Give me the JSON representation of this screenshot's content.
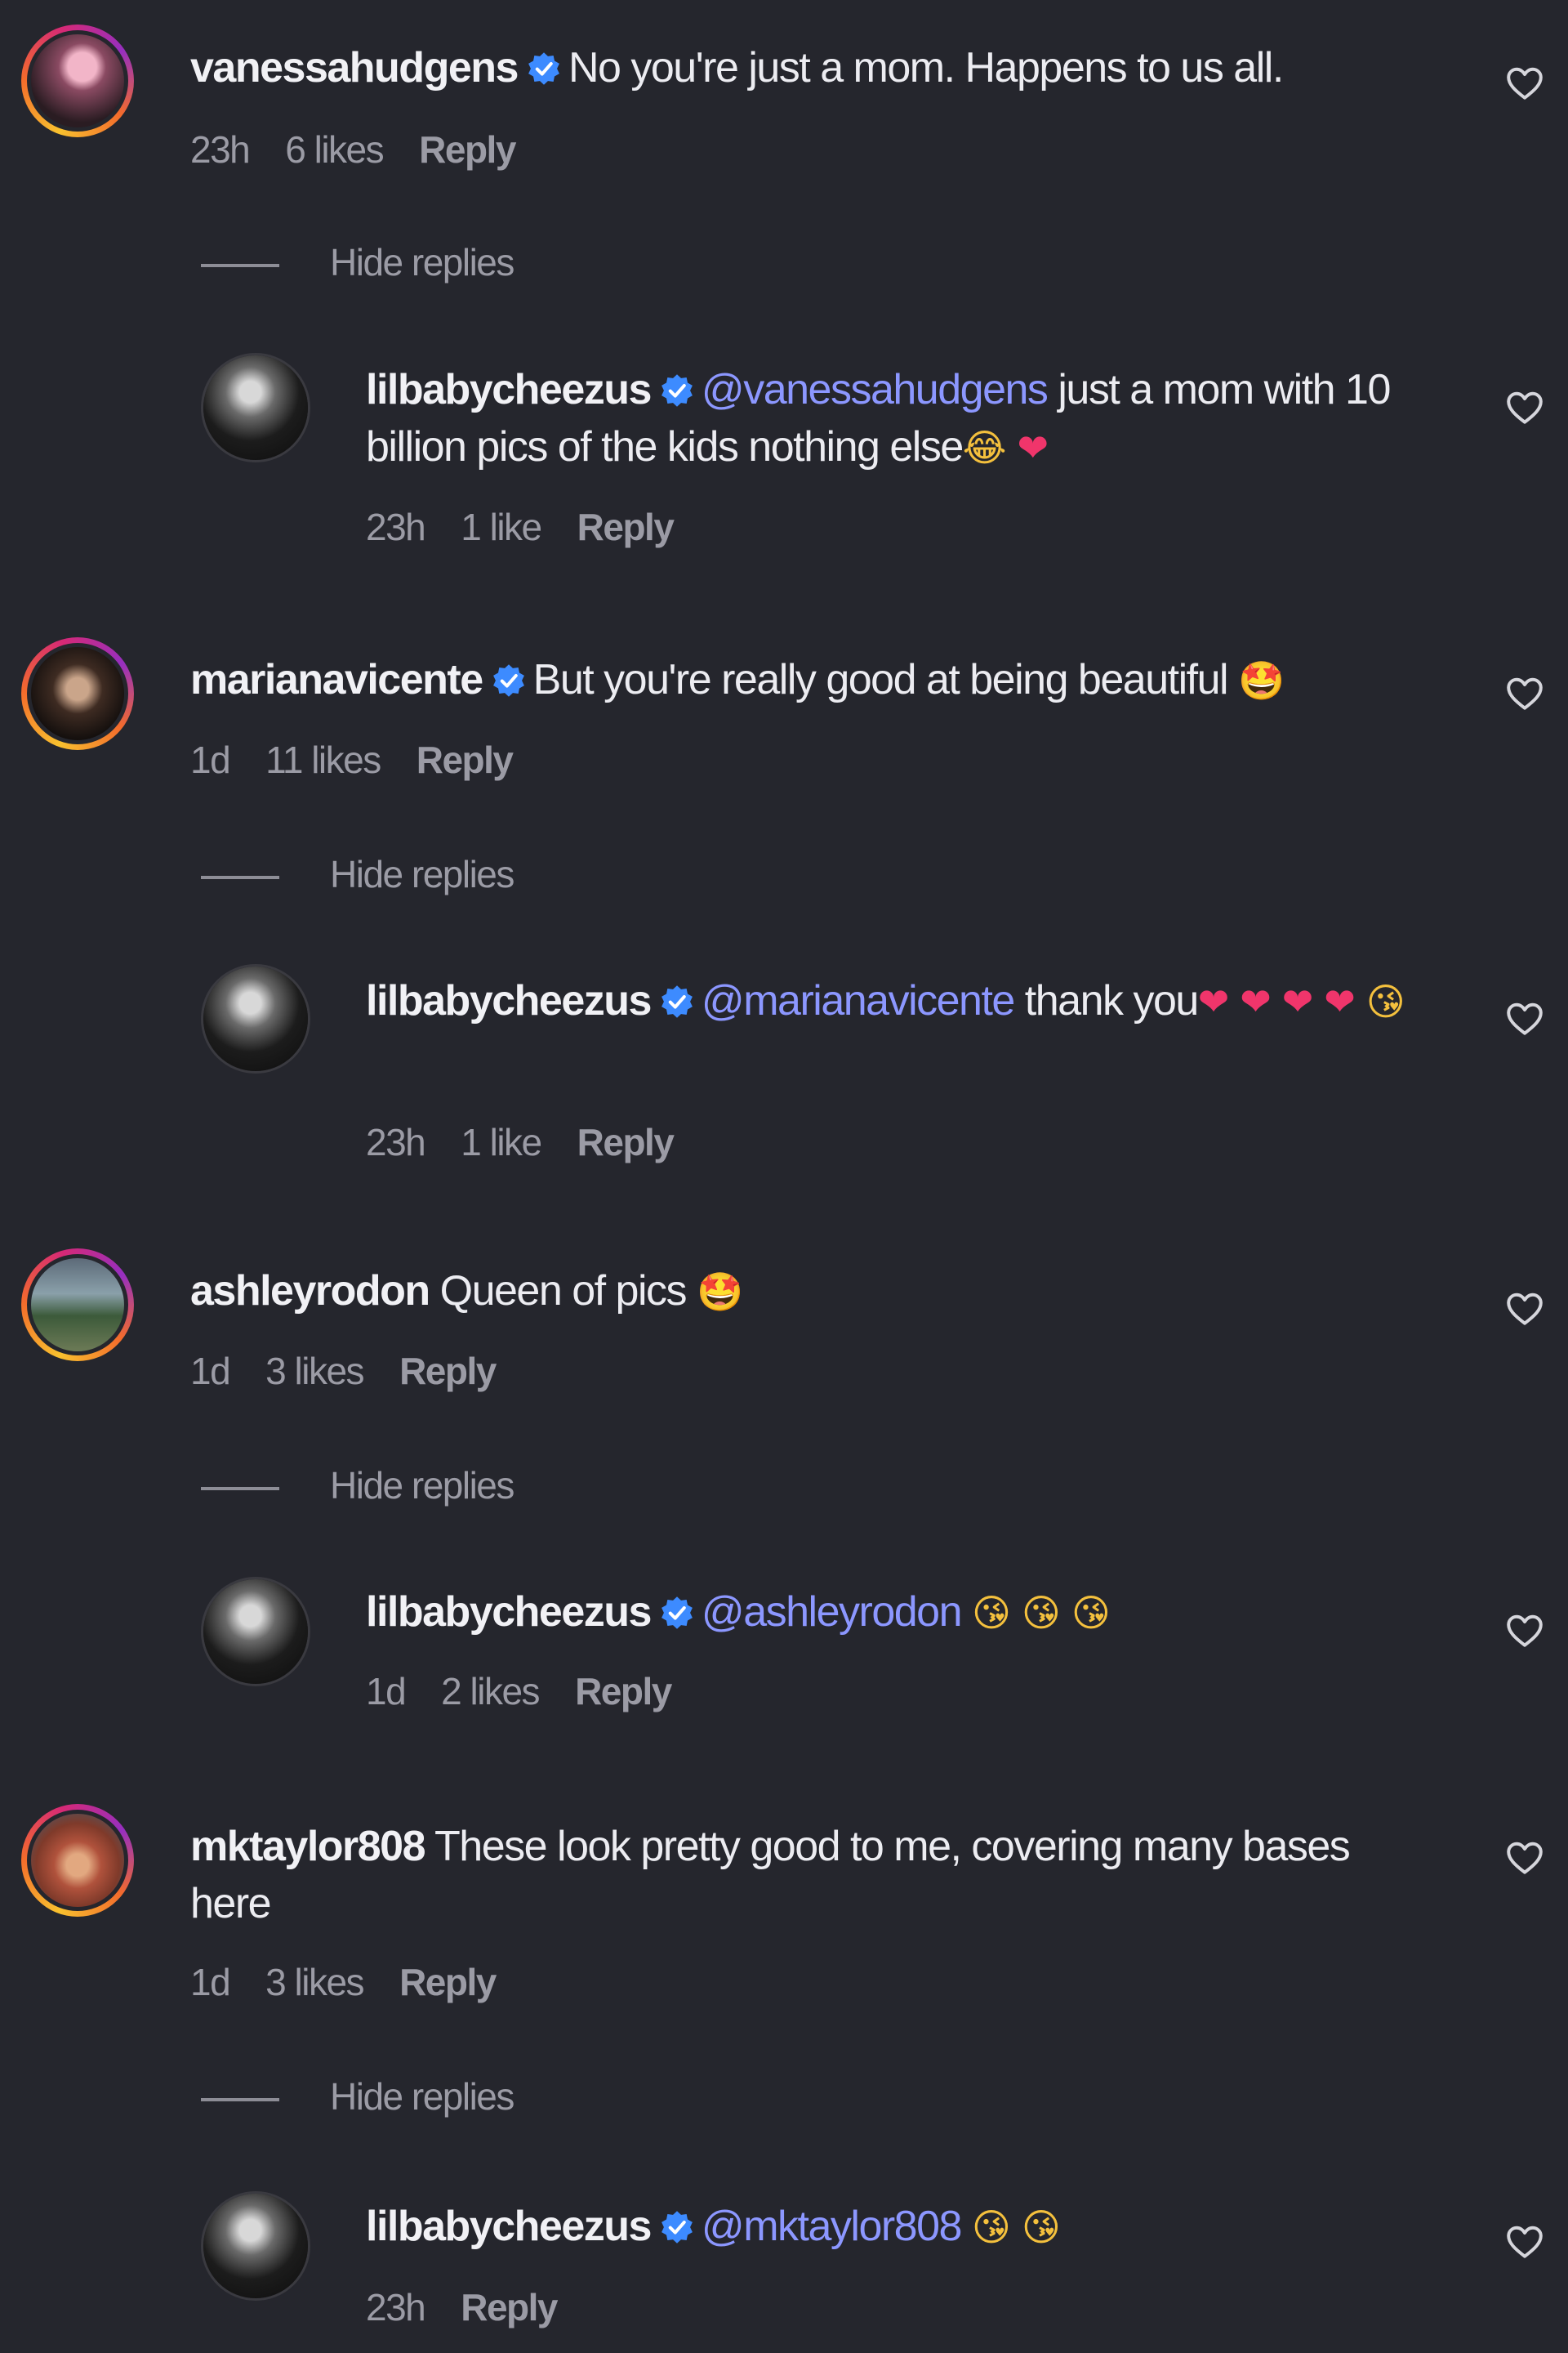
{
  "comments": [
    {
      "user": "vanessahudgens",
      "verified": true,
      "text": "No you're just a mom. Happens to us all.",
      "time": "23h",
      "likes": "6 likes",
      "reply": "Reply",
      "hide_replies": "Hide replies",
      "replies": [
        {
          "user": "lilbabycheezus",
          "verified": true,
          "mention": "@vanessahudgens",
          "text": "just a mom with 10 billion pics of the kids nothing else",
          "emojis": [
            "😂",
            "❤"
          ],
          "time": "23h",
          "likes": "1 like",
          "reply": "Reply"
        }
      ]
    },
    {
      "user": "marianavicente",
      "verified": true,
      "text": "But you're really good at being beautiful",
      "emojis": [
        "🤩"
      ],
      "time": "1d",
      "likes": "11 likes",
      "reply": "Reply",
      "hide_replies": "Hide replies",
      "replies": [
        {
          "user": "lilbabycheezus",
          "verified": true,
          "mention": "@marianavicente",
          "text": "thank you",
          "emojis": [
            "❤",
            "❤",
            "❤",
            "❤",
            "😘"
          ],
          "time": "23h",
          "likes": "1 like",
          "reply": "Reply"
        }
      ]
    },
    {
      "user": "ashleyrodon",
      "verified": false,
      "text": "Queen of pics",
      "emojis": [
        "🤩"
      ],
      "time": "1d",
      "likes": "3 likes",
      "reply": "Reply",
      "hide_replies": "Hide replies",
      "replies": [
        {
          "user": "lilbabycheezus",
          "verified": true,
          "mention": "@ashleyrodon",
          "emojis": [
            "😘",
            "😘",
            "😘"
          ],
          "time": "1d",
          "likes": "2 likes",
          "reply": "Reply"
        }
      ]
    },
    {
      "user": "mktaylor808",
      "verified": false,
      "text": "These look pretty good to me, covering many bases here",
      "time": "1d",
      "likes": "3 likes",
      "reply": "Reply",
      "hide_replies": "Hide replies",
      "replies": [
        {
          "user": "lilbabycheezus",
          "verified": true,
          "mention": "@mktaylor808",
          "emojis": [
            "😘",
            "😘"
          ],
          "time": "23h",
          "reply": "Reply"
        }
      ]
    }
  ],
  "icons": {
    "verified": "verified-badge-icon",
    "like": "heart-outline-icon",
    "verified_color": "#3d8bff"
  }
}
